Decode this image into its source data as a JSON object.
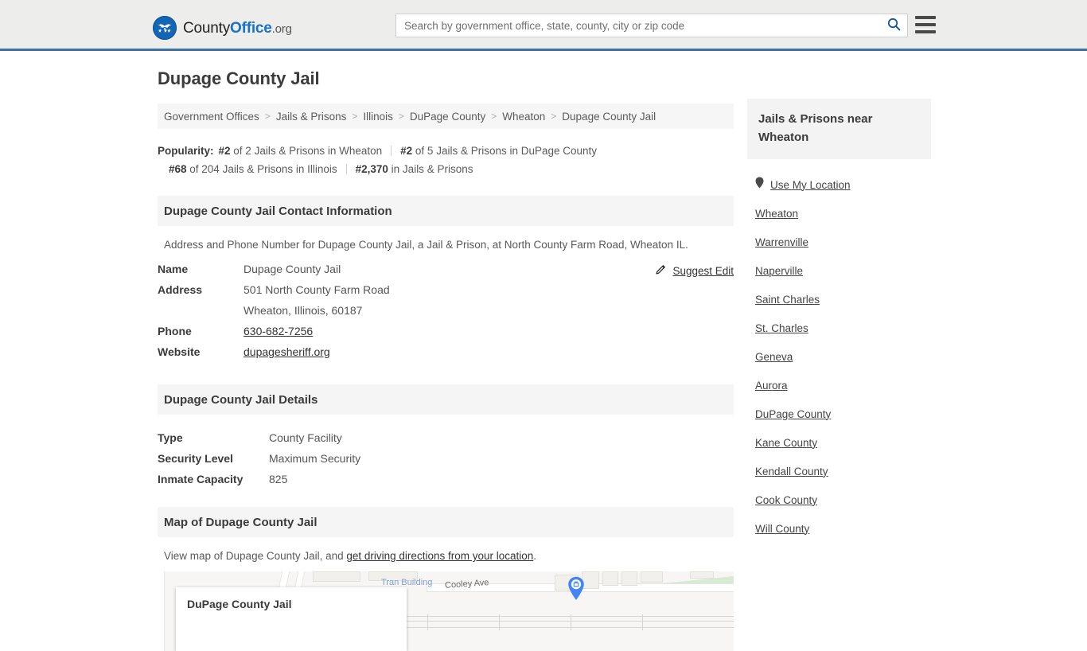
{
  "header": {
    "brand": {
      "part1": "County",
      "part2": "Office",
      "part3": ".org"
    },
    "search": {
      "placeholder": "Search by government office, state, county, city or zip code",
      "value": ""
    },
    "search_icon": "search-icon",
    "menu_icon": "hamburger-menu-icon"
  },
  "page_title": "Dupage County Jail",
  "breadcrumb": {
    "separator": ">",
    "items": [
      "Government Offices",
      "Jails & Prisons",
      "Illinois",
      "DuPage County",
      "Wheaton",
      "Dupage County Jail"
    ]
  },
  "popularity": {
    "label": "Popularity:",
    "items": [
      {
        "rank": "#2",
        "text": " of 2 Jails & Prisons in Wheaton"
      },
      {
        "rank": "#2",
        "text": " of 5 Jails & Prisons in DuPage County"
      },
      {
        "rank": "#68",
        "text": " of 204 Jails & Prisons in Illinois"
      },
      {
        "rank": "#2,370",
        "text": " in Jails & Prisons"
      }
    ]
  },
  "contact": {
    "heading": "Dupage County Jail Contact Information",
    "description": "Address and Phone Number for Dupage County Jail, a Jail & Prison, at North County Farm Road, Wheaton IL.",
    "suggest_edit": "Suggest Edit",
    "rows": [
      {
        "key": "Name",
        "value": "Dupage County Jail",
        "link": false
      },
      {
        "key": "Address",
        "value": "501 North County Farm Road",
        "link": false
      },
      {
        "key": "",
        "value": "Wheaton, Illinois, 60187",
        "link": false
      },
      {
        "key": "Phone",
        "value": "630-682-7256",
        "link": true
      },
      {
        "key": "Website",
        "value": "dupagesheriff.org",
        "link": true
      }
    ]
  },
  "details": {
    "heading": "Dupage County Jail Details",
    "rows": [
      {
        "key": "Type",
        "value": "County Facility"
      },
      {
        "key": "Security Level",
        "value": "Maximum Security"
      },
      {
        "key": "Inmate Capacity",
        "value": "825"
      }
    ]
  },
  "map_section": {
    "heading": "Map of Dupage County Jail",
    "note_before": "View map of Dupage County Jail, and ",
    "note_link": "get driving directions from your location",
    "note_after": ".",
    "card_title": "DuPage County Jail",
    "labels": {
      "street": "Cooley Ave",
      "building": "Tran Building"
    }
  },
  "sidebar": {
    "heading": "Jails & Prisons near Wheaton",
    "use_my_location": "Use My Location",
    "links": [
      "Wheaton",
      "Warrenville",
      "Naperville",
      "Saint Charles",
      "St. Charles",
      "Geneva",
      "Aurora",
      "DuPage County",
      "Kane County",
      "Kendall County",
      "Cook County",
      "Will County"
    ]
  },
  "colors": {
    "brand_blue": "#1873c4",
    "header_bg": "#ededec",
    "header_rule": "#3b72a4",
    "panel_bg": "#f5f5f5",
    "map_pin": "#4285f4"
  }
}
